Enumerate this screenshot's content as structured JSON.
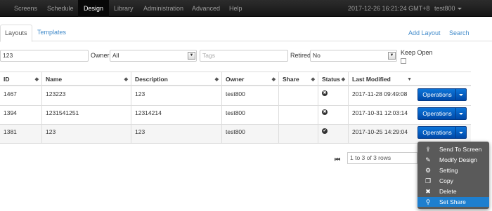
{
  "nav": {
    "items": [
      "Screens",
      "Schedule",
      "Design",
      "Library",
      "Administration",
      "Advanced",
      "Help"
    ],
    "datetime": "2017-12-26 16:21:24 GMT+8",
    "user": "test800"
  },
  "tabs": {
    "layouts": "Layouts",
    "templates": "Templates"
  },
  "actions": {
    "add_layout": "Add Layout",
    "search": "Search"
  },
  "filters": {
    "name_value": "123",
    "owner_label": "Owner",
    "owner_value": "All",
    "tags_placeholder": "Tags",
    "retired_label": "Retired",
    "retired_value": "No",
    "keep_open_label": "Keep Open"
  },
  "table": {
    "columns": [
      "ID",
      "Name",
      "Description",
      "Owner",
      "Share",
      "Status",
      "Last Modified"
    ],
    "rows": [
      {
        "id": "1467",
        "name": "123223",
        "description": "123",
        "owner": "test800",
        "share": "",
        "status": "✖",
        "modified": "2017-11-28 09:49:08"
      },
      {
        "id": "1394",
        "name": "1231541251",
        "description": "12314214",
        "owner": "test800",
        "share": "",
        "status": "✖",
        "modified": "2017-10-31 12:03:14"
      },
      {
        "id": "1381",
        "name": "123",
        "description": "123",
        "owner": "test800",
        "share": "",
        "status": "✔",
        "modified": "2017-10-25 14:29:04"
      }
    ],
    "operations_label": "Operations"
  },
  "pagination": {
    "text": "1 to 3 of 3 rows"
  },
  "menu": {
    "items": [
      {
        "label": "Send To Screen",
        "icon": "upload-icon"
      },
      {
        "label": "Modify Design",
        "icon": "edit-icon"
      },
      {
        "label": "Setting",
        "icon": "gear-icon"
      },
      {
        "label": "Copy",
        "icon": "copy-icon"
      },
      {
        "label": "Delete",
        "icon": "delete-icon"
      },
      {
        "label": "Set Share",
        "icon": "share-icon"
      }
    ]
  }
}
